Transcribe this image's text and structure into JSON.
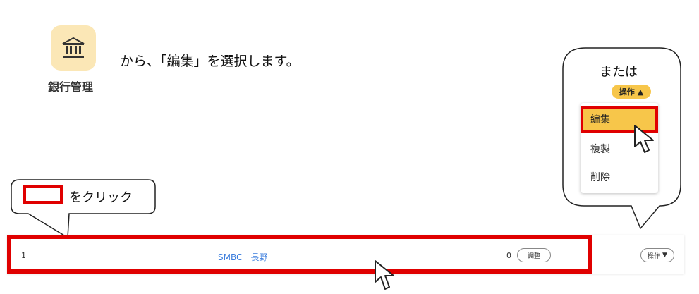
{
  "bank_icon": {
    "label": "銀行管理",
    "icon": "bank-icon"
  },
  "instruction": "から、「編集」を選択します。",
  "callout_right": {
    "title": "または",
    "operation_button": "操作",
    "menu": [
      "編集",
      "複製",
      "削除"
    ]
  },
  "callout_left": {
    "text": "をクリック"
  },
  "row": {
    "index": "1",
    "name": "SMBC　長野",
    "count": "0",
    "adjust_label": "調整",
    "operation_label": "操作"
  },
  "colors": {
    "highlight": "#e00000",
    "accent": "#f7c64a",
    "tile": "#fbe7b6"
  }
}
